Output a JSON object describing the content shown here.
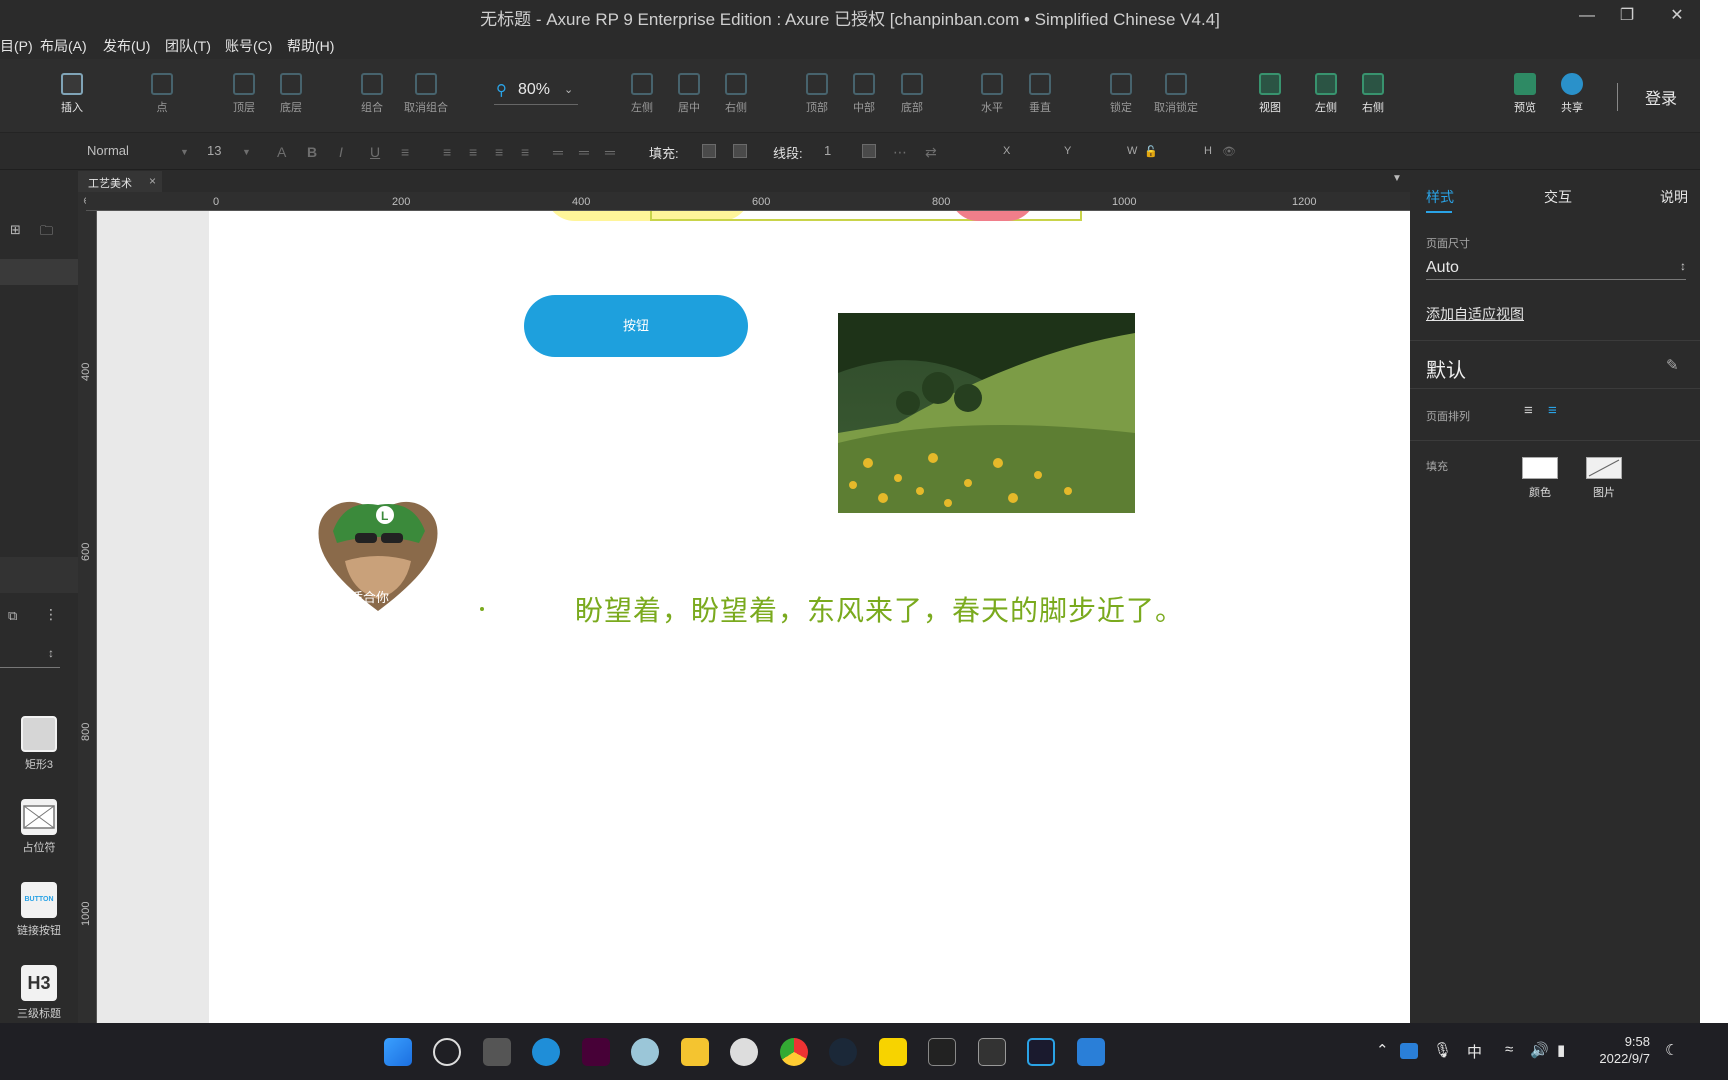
{
  "window": {
    "title": "无标题 - Axure RP 9 Enterprise Edition : Axure 已授权     [chanpinban.com • Simplified Chinese V4.4]",
    "controls": [
      "minimize-icon",
      "restore-icon",
      "close-icon"
    ]
  },
  "menu": [
    "目(P)",
    "布局(A)",
    "发布(U)",
    "团队(T)",
    "账号(C)",
    "帮助(H)"
  ],
  "toolbar": {
    "insert": "插入",
    "point": "点",
    "top_layer": "顶层",
    "bottom_layer": "底层",
    "group": "组合",
    "ungroup": "取消组合",
    "zoom": "80%",
    "align_left": "左侧",
    "align_center": "居中",
    "align_right": "右侧",
    "align_top": "顶部",
    "align_middle": "中部",
    "align_bottom": "底部",
    "dist_h": "水平",
    "dist_v": "垂直",
    "lock": "锁定",
    "unlock": "取消锁定",
    "view": "视图",
    "pane_left": "左侧",
    "pane_right": "右侧",
    "preview": "预览",
    "share": "共享",
    "login": "登录"
  },
  "format": {
    "style": "Normal",
    "font_size": "13",
    "fill_label": "填充:",
    "stroke_label": "线段:",
    "stroke_value": "1",
    "x": "X",
    "y": "Y",
    "w": "W",
    "h": "H"
  },
  "doc_tab": "工艺美术",
  "ruler": {
    "h": [
      "0",
      "200",
      "400",
      "600",
      "800",
      "1000",
      "1200"
    ],
    "v": [
      "400",
      "600",
      "800",
      "1000"
    ]
  },
  "library": [
    {
      "label": "矩形3",
      "icon": "rectangle-icon"
    },
    {
      "label": "占位符",
      "icon": "placeholder-icon"
    },
    {
      "label": "链接按钮",
      "icon": "button-icon",
      "text": "BUTTON"
    },
    {
      "label": "三级标题",
      "icon": "h3-icon",
      "text": "H3"
    }
  ],
  "canvas": {
    "button_label": "按钮",
    "heart_caption": "挺适合你",
    "quote": "盼望着，盼望着，东风来了，春天的脚步近了。"
  },
  "inspector": {
    "tabs": [
      "样式",
      "交互",
      "说明"
    ],
    "page_size_label": "页面尺寸",
    "page_size_value": "Auto",
    "adaptive_link": "添加自适应视图",
    "default_heading": "默认",
    "page_align_label": "页面排列",
    "fill_label": "填充",
    "fill_color": "颜色",
    "fill_image": "图片"
  },
  "taskbar": {
    "apps": [
      "windows-start-icon",
      "search-icon",
      "task-view-icon",
      "edge-icon",
      "xd-icon",
      "settings-icon",
      "file-explorer-icon",
      "alien-icon",
      "chrome-icon",
      "steam-icon",
      "sticky-notes-icon",
      "epic-games-icon",
      "wps-icon",
      "axure-icon",
      "photos-icon"
    ],
    "ime": "中",
    "time": "9:58",
    "date": "2022/9/7"
  },
  "colors": {
    "accent": "#2aa3e6",
    "button": "#1ea0dd",
    "quote": "#7aaa1e"
  }
}
